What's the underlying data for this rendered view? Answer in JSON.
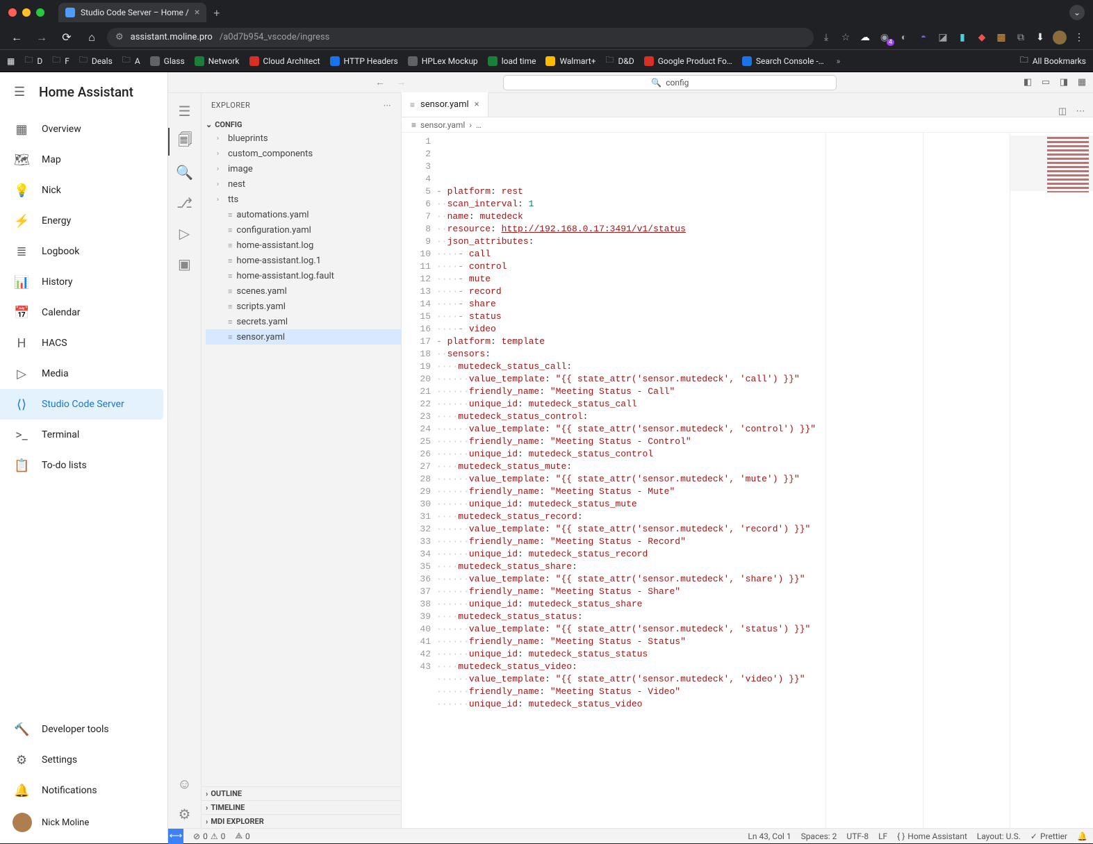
{
  "browser": {
    "tab_title": "Studio Code Server – Home /",
    "url_host": "assistant.moline.pro",
    "url_path": "/a0d7b954_vscode/ingress",
    "badge_count": "4",
    "bookmarks": [
      "D",
      "F",
      "Deals",
      "A",
      "Glass",
      "Network",
      "Cloud Architect",
      "HTTP Headers",
      "HPLex Mockup",
      "load time",
      "Walmart+",
      "D&D",
      "Google Product Fo…",
      "Search Console -…"
    ],
    "all_bookmarks": "All Bookmarks"
  },
  "ha": {
    "title": "Home Assistant",
    "items": [
      {
        "icon": "▦",
        "label": "Overview"
      },
      {
        "icon": "🗺",
        "label": "Map"
      },
      {
        "icon": "💡",
        "label": "Nick"
      },
      {
        "icon": "⚡",
        "label": "Energy"
      },
      {
        "icon": "≣",
        "label": "Logbook"
      },
      {
        "icon": "📊",
        "label": "History"
      },
      {
        "icon": "📅",
        "label": "Calendar"
      },
      {
        "icon": "H",
        "label": "HACS"
      },
      {
        "icon": "▷",
        "label": "Media"
      },
      {
        "icon": "⟨⟩",
        "label": "Studio Code Server"
      },
      {
        "icon": ">_",
        "label": "Terminal"
      },
      {
        "icon": "📋",
        "label": "To-do lists"
      }
    ],
    "active_index": 9,
    "dev_tools": "Developer tools",
    "settings": "Settings",
    "notifications": "Notifications",
    "user": "Nick Moline"
  },
  "vscode": {
    "search_text": "config",
    "explorer_label": "EXPLORER",
    "config_label": "CONFIG",
    "tree_folders": [
      "blueprints",
      "custom_components",
      "image",
      "nest",
      "tts"
    ],
    "tree_files": [
      "automations.yaml",
      "configuration.yaml",
      "home-assistant.log",
      "home-assistant.log.1",
      "home-assistant.log.fault",
      "scenes.yaml",
      "scripts.yaml",
      "secrets.yaml",
      "sensor.yaml"
    ],
    "selected_file": "sensor.yaml",
    "outline": "OUTLINE",
    "timeline": "TIMELINE",
    "mdi_explorer": "MDI EXPLORER",
    "open_tab": "sensor.yaml",
    "breadcrumb_file": "sensor.yaml",
    "breadcrumb_more": "…",
    "code_lines": [
      {
        "n": 1,
        "html": "<span class='dash'>- </span><span class='k'>platform</span>: <span class='k'>rest</span>"
      },
      {
        "n": 2,
        "html": "<span class='dots'>··</span><span class='k'>scan_interval</span>: <span class='n'>1</span>"
      },
      {
        "n": 3,
        "html": "<span class='dots'>··</span><span class='k'>name</span>: <span class='k'>mutedeck</span>"
      },
      {
        "n": 4,
        "html": "<span class='dots'>··</span><span class='k'>resource</span>: <span class='url'>http://192.168.0.17:3491/v1/status</span>"
      },
      {
        "n": 5,
        "html": "<span class='dots'>··</span><span class='k'>json_attributes</span>:"
      },
      {
        "n": 6,
        "html": "<span class='dots'>····</span><span class='dash'>- </span><span class='k'>call</span>"
      },
      {
        "n": 7,
        "html": "<span class='dots'>····</span><span class='dash'>- </span><span class='k'>control</span>"
      },
      {
        "n": 8,
        "html": "<span class='dots'>····</span><span class='dash'>- </span><span class='k'>mute</span>"
      },
      {
        "n": 9,
        "html": "<span class='dots'>····</span><span class='dash'>- </span><span class='k'>record</span>"
      },
      {
        "n": 10,
        "html": "<span class='dots'>····</span><span class='dash'>- </span><span class='k'>share</span>"
      },
      {
        "n": 11,
        "html": "<span class='dots'>····</span><span class='dash'>- </span><span class='k'>status</span>"
      },
      {
        "n": 12,
        "html": "<span class='dots'>····</span><span class='dash'>- </span><span class='k'>video</span>"
      },
      {
        "n": 13,
        "html": "<span class='dash'>- </span><span class='k'>platform</span>: <span class='k'>template</span>"
      },
      {
        "n": 14,
        "html": "<span class='dots'>··</span><span class='k'>sensors</span>:"
      },
      {
        "n": 15,
        "html": "<span class='dots'>····</span><span class='k'>mutedeck_status_call</span>:"
      },
      {
        "n": 16,
        "html": "<span class='dots'>······</span><span class='k'>value_template</span>: <span class='s'>\"{{ state_attr('sensor.mutedeck', 'call') }}\"</span>"
      },
      {
        "n": 17,
        "html": "<span class='dots'>······</span><span class='k'>friendly_name</span>: <span class='s'>\"Meeting Status - Call\"</span>"
      },
      {
        "n": 18,
        "html": "<span class='dots'>······</span><span class='k'>unique_id</span>: <span class='k'>mutedeck_status_call</span>"
      },
      {
        "n": 19,
        "html": "<span class='dots'>····</span><span class='k'>mutedeck_status_control</span>:"
      },
      {
        "n": 20,
        "html": "<span class='dots'>······</span><span class='k'>value_template</span>: <span class='s'>\"{{ state_attr('sensor.mutedeck', 'control') }}\"</span>"
      },
      {
        "n": 21,
        "html": "<span class='dots'>······</span><span class='k'>friendly_name</span>: <span class='s'>\"Meeting Status - Control\"</span>"
      },
      {
        "n": 22,
        "html": "<span class='dots'>······</span><span class='k'>unique_id</span>: <span class='k'>mutedeck_status_control</span>"
      },
      {
        "n": 23,
        "html": "<span class='dots'>····</span><span class='k'>mutedeck_status_mute</span>:"
      },
      {
        "n": 24,
        "html": "<span class='dots'>······</span><span class='k'>value_template</span>: <span class='s'>\"{{ state_attr('sensor.mutedeck', 'mute') }}\"</span>"
      },
      {
        "n": 25,
        "html": "<span class='dots'>······</span><span class='k'>friendly_name</span>: <span class='s'>\"Meeting Status - Mute\"</span>"
      },
      {
        "n": 26,
        "html": "<span class='dots'>······</span><span class='k'>unique_id</span>: <span class='k'>mutedeck_status_mute</span>"
      },
      {
        "n": 27,
        "html": "<span class='dots'>····</span><span class='k'>mutedeck_status_record</span>:"
      },
      {
        "n": 28,
        "html": "<span class='dots'>······</span><span class='k'>value_template</span>: <span class='s'>\"{{ state_attr('sensor.mutedeck', 'record') }}\"</span>"
      },
      {
        "n": 29,
        "html": "<span class='dots'>······</span><span class='k'>friendly_name</span>: <span class='s'>\"Meeting Status - Record\"</span>"
      },
      {
        "n": 30,
        "html": "<span class='dots'>······</span><span class='k'>unique_id</span>: <span class='k'>mutedeck_status_record</span>"
      },
      {
        "n": 31,
        "html": "<span class='dots'>····</span><span class='k'>mutedeck_status_share</span>:"
      },
      {
        "n": 32,
        "html": "<span class='dots'>······</span><span class='k'>value_template</span>: <span class='s'>\"{{ state_attr('sensor.mutedeck', 'share') }}\"</span>"
      },
      {
        "n": 33,
        "html": "<span class='dots'>······</span><span class='k'>friendly_name</span>: <span class='s'>\"Meeting Status - Share\"</span>"
      },
      {
        "n": 34,
        "html": "<span class='dots'>······</span><span class='k'>unique_id</span>: <span class='k'>mutedeck_status_share</span>"
      },
      {
        "n": 35,
        "html": "<span class='dots'>····</span><span class='k'>mutedeck_status_status</span>:"
      },
      {
        "n": 36,
        "html": "<span class='dots'>······</span><span class='k'>value_template</span>: <span class='s'>\"{{ state_attr('sensor.mutedeck', 'status') }}\"</span>"
      },
      {
        "n": 37,
        "html": "<span class='dots'>······</span><span class='k'>friendly_name</span>: <span class='s'>\"Meeting Status - Status\"</span>"
      },
      {
        "n": 38,
        "html": "<span class='dots'>······</span><span class='k'>unique_id</span>: <span class='k'>mutedeck_status_status</span>"
      },
      {
        "n": 39,
        "html": "<span class='dots'>····</span><span class='k'>mutedeck_status_video</span>:"
      },
      {
        "n": 40,
        "html": "<span class='dots'>······</span><span class='k'>value_template</span>: <span class='s'>\"{{ state_attr('sensor.mutedeck', 'video') }}\"</span>"
      },
      {
        "n": 41,
        "html": "<span class='dots'>······</span><span class='k'>friendly_name</span>: <span class='s'>\"Meeting Status - Video\"</span>"
      },
      {
        "n": 42,
        "html": "<span class='dots'>······</span><span class='k'>unique_id</span>: <span class='k'>mutedeck_status_video</span>"
      },
      {
        "n": 43,
        "html": ""
      }
    ],
    "status": {
      "errors": "0",
      "warnings": "0",
      "ports": "0",
      "cursor": "Ln 43, Col 1",
      "spaces": "Spaces: 2",
      "encoding": "UTF-8",
      "eol": "LF",
      "lang": "Home Assistant",
      "layout": "Layout: U.S.",
      "prettier": "Prettier"
    }
  }
}
